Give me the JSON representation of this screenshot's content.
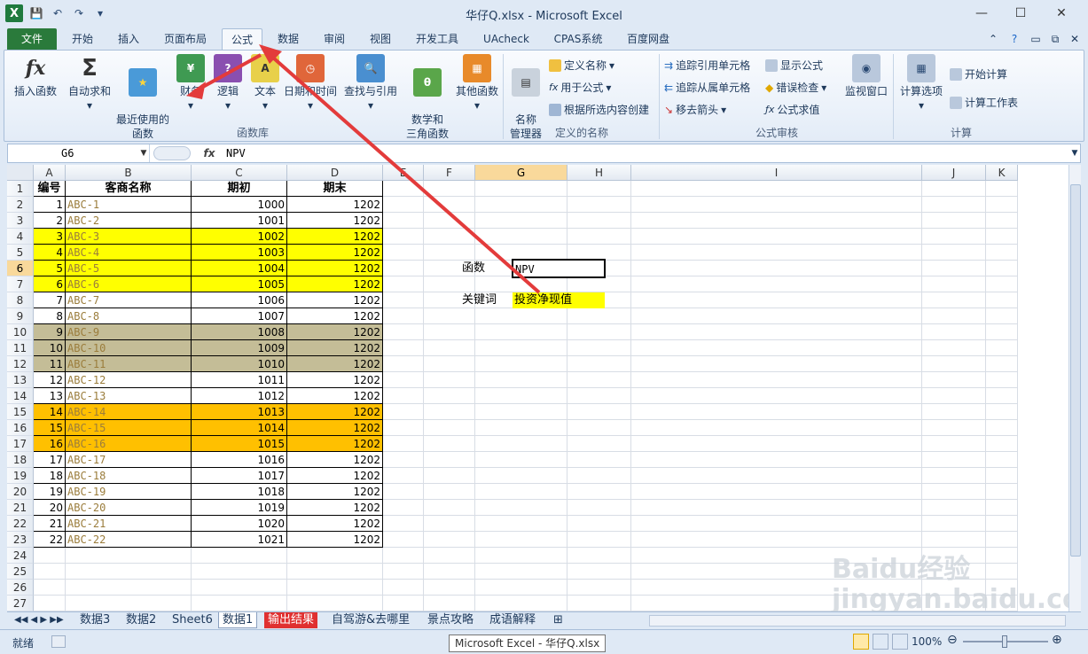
{
  "window": {
    "title": "华仔Q.xlsx - Microsoft Excel",
    "app_icon": "X"
  },
  "tabs": [
    "文件",
    "开始",
    "插入",
    "页面布局",
    "公式",
    "数据",
    "审阅",
    "视图",
    "开发工具",
    "UAcheck",
    "CPAS系统",
    "百度网盘"
  ],
  "ribbon": {
    "function_library": {
      "label": "函数库",
      "insert_function": "插入函数",
      "autosum": "自动求和",
      "recent": "最近使用的\n函数",
      "financial": "财务",
      "logical": "逻辑",
      "text": "文本",
      "datetime": "日期和时间",
      "lookup": "查找与引用",
      "math": "数学和\n三角函数",
      "other": "其他函数"
    },
    "defined_names": {
      "label": "定义的名称",
      "name_manager": "名称\n管理器",
      "define_name": "定义名称",
      "use_in_formula": "用于公式",
      "create_from_selection": "根据所选内容创建"
    },
    "auditing": {
      "label": "公式审核",
      "trace_precedents": "追踪引用单元格",
      "trace_dependents": "追踪从属单元格",
      "remove_arrows": "移去箭头",
      "show_formulas": "显示公式",
      "error_checking": "错误检查",
      "evaluate": "公式求值",
      "watch": "监视窗口"
    },
    "calculation": {
      "label": "计算",
      "options": "计算选项",
      "calc_now": "开始计算",
      "calc_sheet": "计算工作表"
    }
  },
  "formula_bar": {
    "name_box": "G6",
    "fx": "fx",
    "content": "NPV"
  },
  "columns": [
    "A",
    "B",
    "C",
    "D",
    "E",
    "F",
    "G",
    "H",
    "I",
    "J",
    "K"
  ],
  "headers": [
    "编号",
    "客商名称",
    "期初",
    "期末"
  ],
  "rows": [
    {
      "no": "1",
      "name": "ABC-1",
      "begin": "1000",
      "end": "1202",
      "fill": ""
    },
    {
      "no": "2",
      "name": "ABC-2",
      "begin": "1001",
      "end": "1202",
      "fill": ""
    },
    {
      "no": "3",
      "name": "ABC-3",
      "begin": "1002",
      "end": "1202",
      "fill": "#ffff00"
    },
    {
      "no": "4",
      "name": "ABC-4",
      "begin": "1003",
      "end": "1202",
      "fill": "#ffff00"
    },
    {
      "no": "5",
      "name": "ABC-5",
      "begin": "1004",
      "end": "1202",
      "fill": "#ffff00"
    },
    {
      "no": "6",
      "name": "ABC-6",
      "begin": "1005",
      "end": "1202",
      "fill": "#ffff00"
    },
    {
      "no": "7",
      "name": "ABC-7",
      "begin": "1006",
      "end": "1202",
      "fill": ""
    },
    {
      "no": "8",
      "name": "ABC-8",
      "begin": "1007",
      "end": "1202",
      "fill": ""
    },
    {
      "no": "9",
      "name": "ABC-9",
      "begin": "1008",
      "end": "1202",
      "fill": "#c4bd97"
    },
    {
      "no": "10",
      "name": "ABC-10",
      "begin": "1009",
      "end": "1202",
      "fill": "#c4bd97"
    },
    {
      "no": "11",
      "name": "ABC-11",
      "begin": "1010",
      "end": "1202",
      "fill": "#c4bd97"
    },
    {
      "no": "12",
      "name": "ABC-12",
      "begin": "1011",
      "end": "1202",
      "fill": ""
    },
    {
      "no": "13",
      "name": "ABC-13",
      "begin": "1012",
      "end": "1202",
      "fill": ""
    },
    {
      "no": "14",
      "name": "ABC-14",
      "begin": "1013",
      "end": "1202",
      "fill": "#ffc000"
    },
    {
      "no": "15",
      "name": "ABC-15",
      "begin": "1014",
      "end": "1202",
      "fill": "#ffc000"
    },
    {
      "no": "16",
      "name": "ABC-16",
      "begin": "1015",
      "end": "1202",
      "fill": "#ffc000"
    },
    {
      "no": "17",
      "name": "ABC-17",
      "begin": "1016",
      "end": "1202",
      "fill": ""
    },
    {
      "no": "18",
      "name": "ABC-18",
      "begin": "1017",
      "end": "1202",
      "fill": ""
    },
    {
      "no": "19",
      "name": "ABC-19",
      "begin": "1018",
      "end": "1202",
      "fill": ""
    },
    {
      "no": "20",
      "name": "ABC-20",
      "begin": "1019",
      "end": "1202",
      "fill": ""
    },
    {
      "no": "21",
      "name": "ABC-21",
      "begin": "1020",
      "end": "1202",
      "fill": ""
    },
    {
      "no": "22",
      "name": "ABC-22",
      "begin": "1021",
      "end": "1202",
      "fill": ""
    }
  ],
  "row_numbers": [
    "1",
    "2",
    "3",
    "4",
    "5",
    "6",
    "7",
    "8",
    "9",
    "10",
    "11",
    "12",
    "13",
    "14",
    "15",
    "16",
    "17",
    "18",
    "19",
    "20",
    "21",
    "22",
    "23",
    "24",
    "25",
    "26",
    "27"
  ],
  "side_cells": {
    "f6": "函数",
    "g6": "NPV",
    "f8": "关键词",
    "g8": "投资净现值"
  },
  "sheet_tabs": [
    "数据3",
    "数据2",
    "Sheet6",
    "数据1",
    "输出结果",
    "自驾游&去哪里",
    "景点攻略",
    "成语解释"
  ],
  "status": {
    "ready": "就绪",
    "zoom": "100%",
    "tooltip": "Microsoft Excel - 华仔Q.xlsx"
  },
  "watermark": "Baidu经验 jingyan.baidu.com"
}
